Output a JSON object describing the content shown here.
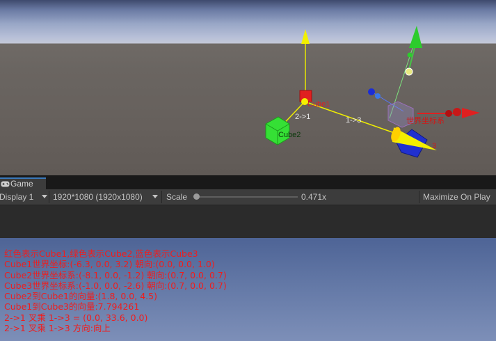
{
  "scene": {
    "labels": {
      "cube1": "Cube1",
      "cube2": "Cube2",
      "cube3_partial": "3",
      "vec_2_1": "2->1",
      "vec_1_3": "1->3",
      "world_axes": "世界坐标系"
    }
  },
  "tabs": {
    "game": "Game"
  },
  "toolbar": {
    "display": "Display 1",
    "resolution": "1920*1080 (1920x1080)",
    "scale_label": "Scale",
    "scale_value": "0.471x",
    "scale_fraction": 0.03,
    "maximize": "Maximize On Play"
  },
  "info_lines": [
    "红色表示Cube1,绿色表示Cube2,蓝色表示Cube3",
    "Cube1世界坐标:(-6.3, 0.0, 3.2) 朝向:(0.0, 0.0, 1.0)",
    "Cube2世界坐标系:(-8.1, 0.0, -1.2) 朝向:(0.7, 0.0, 0.7)",
    "Cube3世界坐标系:(-1.0, 0.0, -2.6) 朝向:(0.7, 0.0, 0.7)",
    "Cube2到Cube1的向量:(1.8, 0.0, 4.5)",
    "Cube1到Cube3的向量:7.794261",
    "2->1 叉乘 1->3 = (0.0, 33.6, 0.0)",
    "2->1 叉乘 1->3 方向:向上"
  ],
  "colors": {
    "text_red": "#ef1d1d",
    "cube1": "#e02020",
    "cube2": "#35e035",
    "cube3": "#2030d0",
    "vector_yellow": "#f0ee00",
    "tab_accent": "#3a79bb"
  }
}
